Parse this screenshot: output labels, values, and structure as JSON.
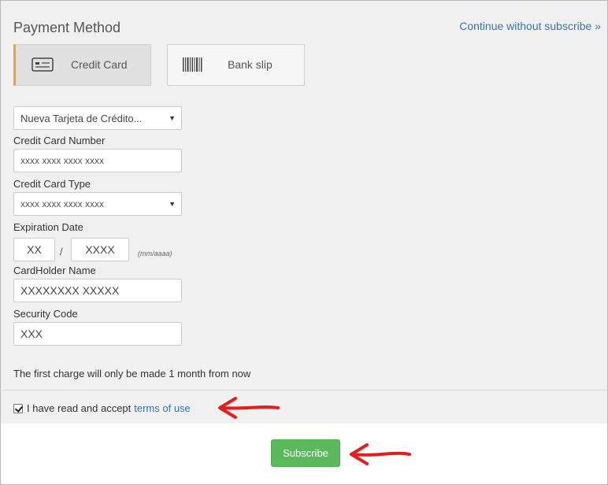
{
  "header": {
    "title": "Payment Method",
    "skip_link": "Continue without subscribe »"
  },
  "tabs": [
    {
      "label": "Credit Card",
      "icon": "credit-card-icon",
      "active": true
    },
    {
      "label": "Bank slip",
      "icon": "barcode-icon",
      "active": false
    }
  ],
  "form": {
    "card_select": "Nueva Tarjeta de Crédito...",
    "number_label": "Credit Card Number",
    "number_placeholder": "xxxx xxxx xxxx xxxx",
    "type_label": "Credit Card Type",
    "type_value": "xxxx xxxx xxxx xxxx",
    "expiration_label": "Expiration Date",
    "month_value": "XX",
    "year_value": "XXXX",
    "date_hint": "(mm/aaaa)",
    "holder_label": "CardHolder Name",
    "holder_value": "XXXXXXXX XXXXX",
    "security_label": "Security Code",
    "security_value": "XXX"
  },
  "notice": "The first charge will only be made 1 month from now",
  "terms": {
    "checked": true,
    "text": "I have read and accept",
    "link": "terms of use"
  },
  "subscribe_label": "Subscribe",
  "colors": {
    "accent_link": "#3d74a8",
    "active_tab_marker": "#f0a030",
    "button_green": "#5cb85c",
    "annotation_arrow": "#e0201c"
  }
}
